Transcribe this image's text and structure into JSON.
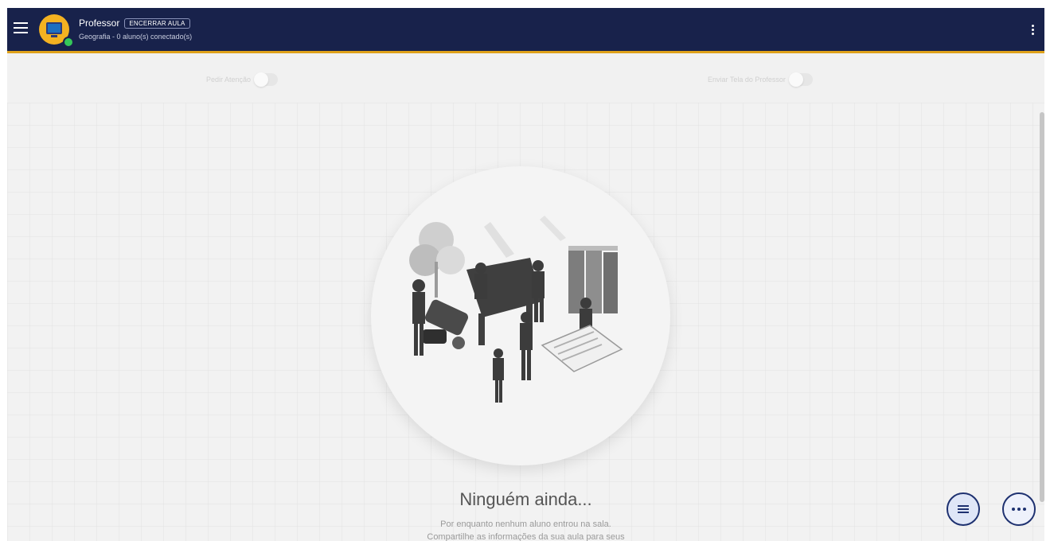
{
  "appbar": {
    "title": "Professor",
    "end_class_label": "ENCERRAR AULA",
    "subtitle": "Geografia - 0 aluno(s) conectado(s)"
  },
  "toolbar": {
    "toggle_attention_label": "Pedir Atenção",
    "toggle_share_screen_label": "Enviar Tela do Professor"
  },
  "empty_state": {
    "title": "Ninguém ainda...",
    "line1": "Por enquanto nenhum aluno entrou na sala.",
    "line2": "Compartilhe as informações da sua aula para seus"
  },
  "colors": {
    "appbar_bg": "#18224b",
    "accent_gold": "#e0a21b",
    "fab_border": "#1e3170"
  },
  "icons": {
    "menu": "hamburger-icon",
    "more": "kebab-icon",
    "list": "list-icon",
    "more_fab": "more-horizontal-icon"
  }
}
